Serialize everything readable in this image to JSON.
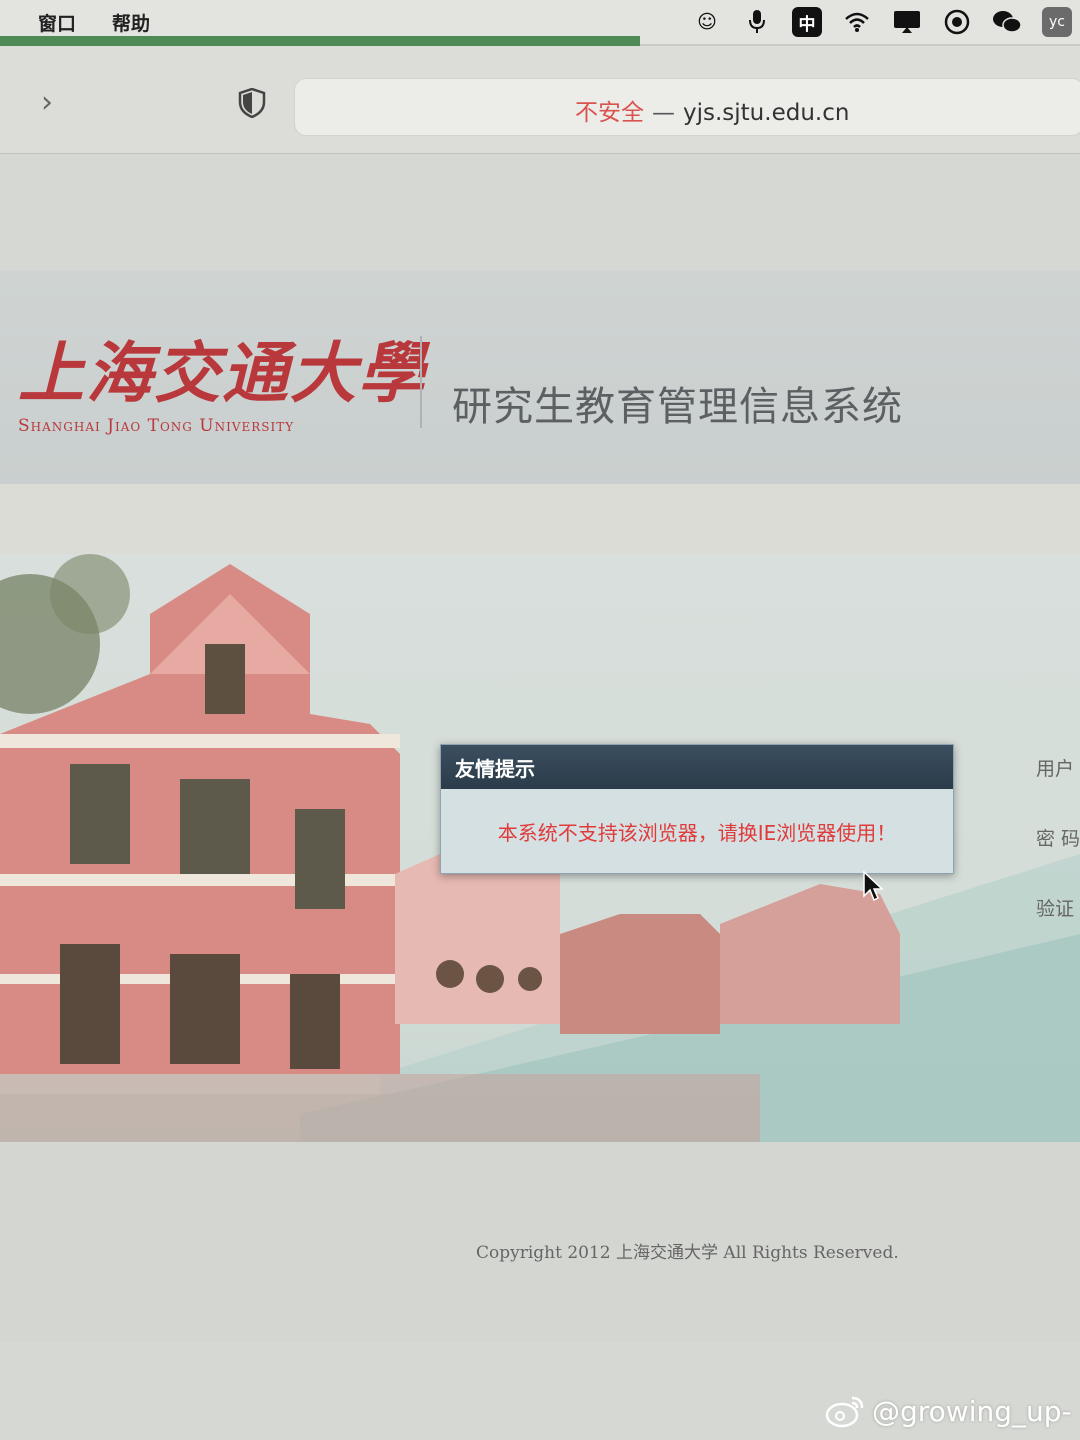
{
  "menubar": {
    "items": [
      "窗口",
      "帮助"
    ],
    "tray": {
      "input_method": "中",
      "avatar": "yc"
    }
  },
  "browser": {
    "address": {
      "security": "不安全",
      "separator": "—",
      "domain": "yjs.sjtu.edu.cn"
    }
  },
  "header": {
    "logo_cn": "上海交通大學",
    "logo_en": "Shanghai Jiao Tong University",
    "system_title": "研究生教育管理信息系统"
  },
  "login": {
    "labels": [
      "用户",
      "密 码",
      "验证"
    ]
  },
  "dialog": {
    "title": "友情提示",
    "message": "本系统不支持该浏览器，请换IE浏览器使用！"
  },
  "footer": {
    "copyright": "Copyright 2012 上海交通大学 All Rights Reserved."
  },
  "watermark": {
    "text": "@growing_up-"
  },
  "colors": {
    "brand_red": "#b8383c",
    "insecure_red": "#d9534f",
    "dialog_header": "#2b3b4a",
    "dialog_message": "#e03b3b"
  }
}
